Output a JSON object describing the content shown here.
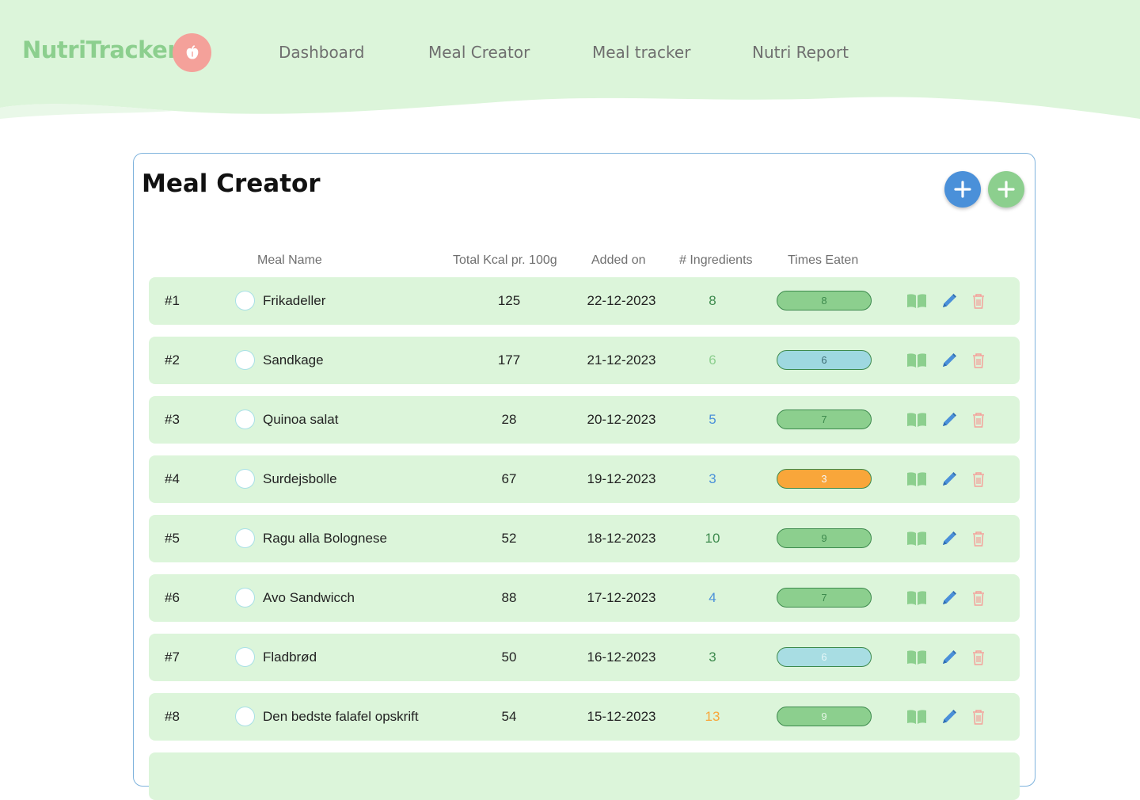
{
  "brand": {
    "name": "NutriTracker"
  },
  "nav": [
    "Dashboard",
    "Meal Creator",
    "Meal tracker",
    "Nutri Report"
  ],
  "page": {
    "title": "Meal Creator"
  },
  "columns": {
    "meal_name": "Meal Name",
    "kcal": "Total Kcal pr. 100g",
    "added_on": "Added on",
    "ingredients": "# Ingredients",
    "times_eaten": "Times Eaten"
  },
  "colors": {
    "brand_green": "#8ccf8e",
    "row_bg": "#dcf5da",
    "accent_blue": "#4a90d9",
    "delete_red": "#f4a19a"
  },
  "meals": [
    {
      "id": "#1",
      "name": "Frikadeller",
      "kcal": "125",
      "added": "22-12-2023",
      "ingredients": "8",
      "ingredients_color": "#3d8a4d",
      "times": "8",
      "pill_bg": "#8ccf8e",
      "pill_text": "#3d8a4d"
    },
    {
      "id": "#2",
      "name": "Sandkage",
      "kcal": "177",
      "added": "21-12-2023",
      "ingredients": "6",
      "ingredients_color": "#8ccf8e",
      "times": "6",
      "pill_bg": "#9ed8e0",
      "pill_text": "#3f6f75"
    },
    {
      "id": "#3",
      "name": "Quinoa salat",
      "kcal": "28",
      "added": "20-12-2023",
      "ingredients": "5",
      "ingredients_color": "#4a90d9",
      "times": "7",
      "pill_bg": "#8ccf8e",
      "pill_text": "#3d8a4d"
    },
    {
      "id": "#4",
      "name": "Surdejsbolle",
      "kcal": "67",
      "added": "19-12-2023",
      "ingredients": "3",
      "ingredients_color": "#4a90d9",
      "times": "3",
      "pill_bg": "#f9a63a",
      "pill_text": "#f6f6f6"
    },
    {
      "id": "#5",
      "name": "Ragu alla Bolognese",
      "kcal": "52",
      "added": "18-12-2023",
      "ingredients": "10",
      "ingredients_color": "#3d8a4d",
      "times": "9",
      "pill_bg": "#8ccf8e",
      "pill_text": "#3d8a4d"
    },
    {
      "id": "#6",
      "name": "Avo Sandwicch",
      "kcal": "88",
      "added": "17-12-2023",
      "ingredients": "4",
      "ingredients_color": "#4a90d9",
      "times": "7",
      "pill_bg": "#8ccf8e",
      "pill_text": "#3d8a4d"
    },
    {
      "id": "#7",
      "name": "Fladbrød",
      "kcal": "50",
      "added": "16-12-2023",
      "ingredients": "3",
      "ingredients_color": "#3d8a4d",
      "times": "6",
      "pill_bg": "#a8dde3",
      "pill_text": "#e6f7f8"
    },
    {
      "id": "#8",
      "name": "Den bedste falafel opskrift",
      "kcal": "54",
      "added": "15-12-2023",
      "ingredients": "13",
      "ingredients_color": "#f9a63a",
      "times": "9",
      "pill_bg": "#8ccf8e",
      "pill_text": "#e6f7e6"
    }
  ]
}
